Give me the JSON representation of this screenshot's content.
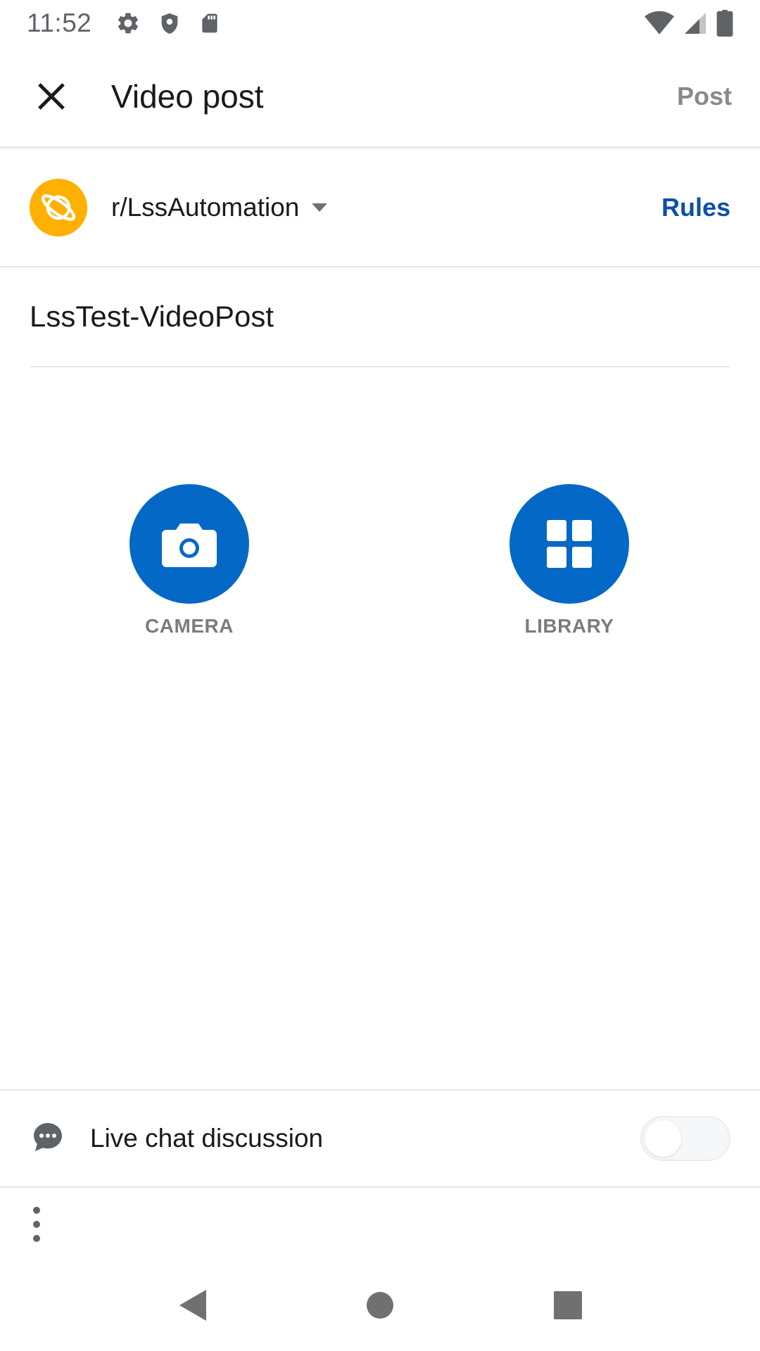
{
  "status_bar": {
    "time": "11:52",
    "icons": [
      "settings-icon",
      "shield-icon",
      "sd-card-icon",
      "wifi-icon",
      "cell-signal-icon",
      "battery-icon"
    ]
  },
  "toolbar": {
    "title": "Video post",
    "post_label": "Post",
    "close_icon": "close-icon"
  },
  "community": {
    "name": "r/LssAutomation",
    "rules_label": "Rules",
    "avatar_color": "#ffb000"
  },
  "post": {
    "title_value": "LssTest-VideoPost"
  },
  "media_options": [
    {
      "label": "CAMERA",
      "icon": "camera-icon"
    },
    {
      "label": "LIBRARY",
      "icon": "grid-icon"
    }
  ],
  "live_chat": {
    "label": "Live chat discussion",
    "enabled": false
  },
  "colors": {
    "accent_blue": "#0468c6",
    "link_blue": "#0f4fa8",
    "disabled_gray": "#878a8c"
  }
}
